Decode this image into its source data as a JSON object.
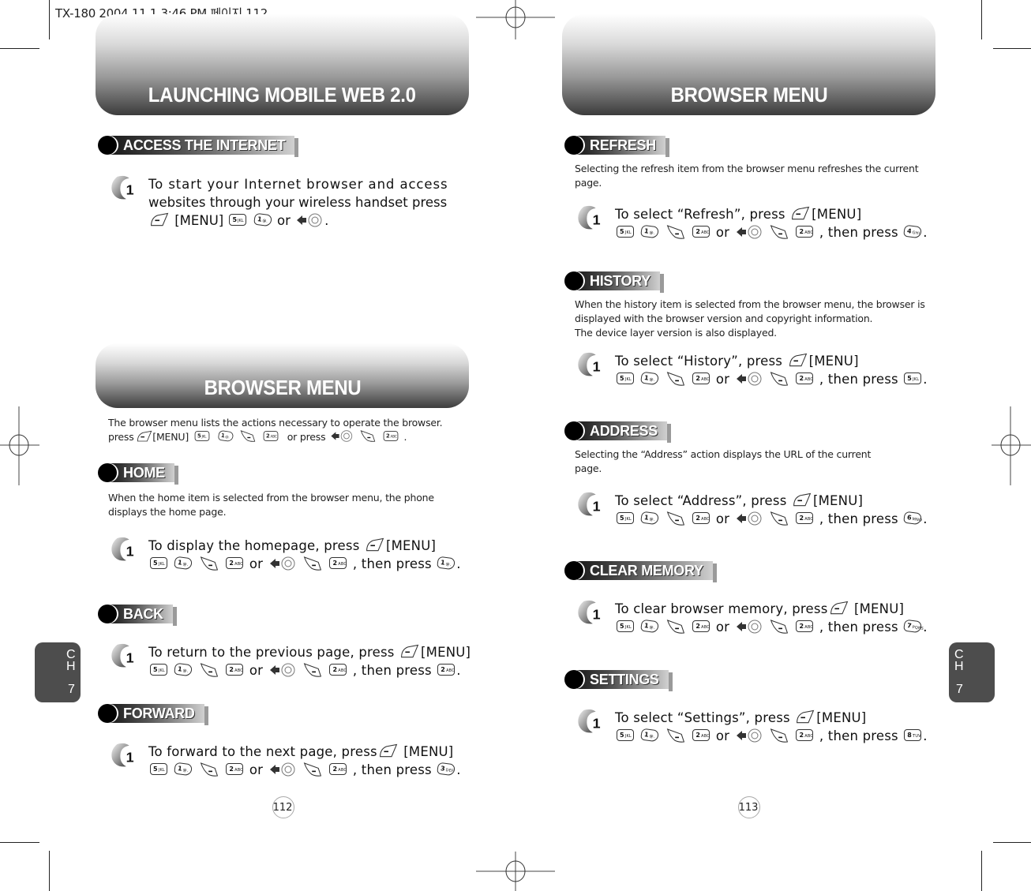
{
  "print_header": "TX-180  2004.11.1 3:46 PM 페이지 112",
  "left_page": {
    "banner_title": "LAUNCHING MOBILE WEB 2.0",
    "access_section": {
      "heading": "ACCESS THE INTERNET",
      "step_number": "1",
      "step_line1": "To start your Internet browser and access",
      "step_line2": "websites through your wireless handset press",
      "step_line3_menu": "[MENU]",
      "step_line3_or": "or",
      "step_line3_end": "."
    },
    "browser_menu": {
      "banner_title": "BROWSER MENU",
      "intro_line1": "The browser menu lists the actions necessary to operate the browser.",
      "intro_press": "press",
      "intro_menu": "[MENU]",
      "intro_or_press": "or press",
      "intro_end": "."
    },
    "sections": [
      {
        "heading": "HOME",
        "description_line1": "When the home item is selected from the browser menu, the phone",
        "description_line2": "displays the home page.",
        "step_number": "1",
        "step_lead": "To display the homepage, press",
        "step_menu": "[MENU]",
        "step_or": "or",
        "step_then": ", then press",
        "final_key": "1",
        "final_key_sub": "@.",
        "step_end": "."
      },
      {
        "heading": "BACK",
        "step_number": "1",
        "step_lead": "To return to the previous page, press",
        "step_menu": "[MENU]",
        "step_or": "or",
        "step_then": ", then press",
        "final_key": "2",
        "final_key_sub": "ABC",
        "step_end": "."
      },
      {
        "heading": "FORWARD",
        "step_number": "1",
        "step_lead": "To forward to the next page, press",
        "step_menu": "[MENU]",
        "step_or": "or",
        "step_then": ", then press",
        "final_key": "3",
        "final_key_sub": "DEF",
        "step_end": "."
      }
    ],
    "page_number": "112",
    "chapter_tab": {
      "c": "C",
      "h": "H",
      "num": "7"
    }
  },
  "right_page": {
    "banner_title": "BROWSER MENU",
    "sections": [
      {
        "heading": "REFRESH",
        "description_line1": "Selecting the refresh item from the browser menu refreshes the current",
        "description_line2": "page.",
        "step_number": "1",
        "step_lead": "To select “Refresh”, press",
        "step_menu": "[MENU]",
        "step_or": "or",
        "step_then": ", then press",
        "final_key": "4",
        "final_key_sub": "GHI",
        "step_end": "."
      },
      {
        "heading": "HISTORY",
        "description_line1": "When the history item is selected from the browser menu, the browser is",
        "description_line2": "displayed with the browser version and copyright information.",
        "description_line3": "The device layer version is also displayed.",
        "step_number": "1",
        "step_lead": "To select “History”, press",
        "step_menu": "[MENU]",
        "step_or": "or",
        "step_then": ", then press",
        "final_key": "5",
        "final_key_sub": "JKL",
        "step_end": "."
      },
      {
        "heading": "ADDRESS",
        "description_line1": "Selecting the “Address” action displays the URL of the current",
        "description_line2": "page.",
        "step_number": "1",
        "step_lead": "To select “Address”, press",
        "step_menu": "[MENU]",
        "step_or": "or",
        "step_then": ", then press",
        "final_key": "6",
        "final_key_sub": "MNO",
        "step_end": "."
      },
      {
        "heading": "CLEAR MEMORY",
        "step_number": "1",
        "step_lead": "To clear browser memory, press",
        "step_menu": "[MENU]",
        "step_or": "or",
        "step_then": ", then press",
        "final_key": "7",
        "final_key_sub": "PQRS",
        "step_end": "."
      },
      {
        "heading": "SETTINGS",
        "step_number": "1",
        "step_lead": "To select “Settings”, press",
        "step_menu": "[MENU]",
        "step_or": "or",
        "step_then": ", then press",
        "final_key": "8",
        "final_key_sub": "TUV",
        "step_end": "."
      }
    ],
    "page_number": "113",
    "chapter_tab": {
      "c": "C",
      "h": "H",
      "num": "7"
    }
  },
  "keys": {
    "k5": "5",
    "k5_sub": "JKL",
    "k1": "1",
    "k1_sub": "@.",
    "k2": "2",
    "k2_sub": "ABC"
  },
  "icons": {
    "softkey_left": "left-softkey-icon",
    "softkey_right": "right-softkey-icon",
    "nav_left": "nav-left-arrow-icon",
    "nav_center": "nav-ok-icon",
    "step_badge": "step-number-badge-icon",
    "registration_mark": "registration-mark-icon"
  }
}
